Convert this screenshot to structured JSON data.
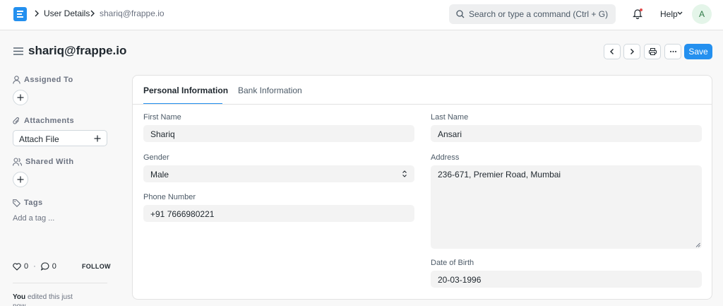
{
  "navbar": {
    "breadcrumb": [
      "User Details",
      "shariq@frappe.io"
    ],
    "search_placeholder": "Search or type a command (Ctrl + G)",
    "help_label": "Help",
    "avatar_initial": "A"
  },
  "page": {
    "title": "shariq@frappe.io",
    "save_label": "Save"
  },
  "sidebar": {
    "assigned_to_label": "Assigned To",
    "attachments_label": "Attachments",
    "attach_file_label": "Attach File",
    "shared_with_label": "Shared With",
    "tags_label": "Tags",
    "add_tag_label": "Add a tag ...",
    "likes_count": "0",
    "comments_count": "0",
    "follow_label": "FOLLOW",
    "activity_user": "You",
    "activity_text": "edited this just now"
  },
  "form": {
    "tabs": [
      "Personal Information",
      "Bank Information"
    ],
    "fields": {
      "first_name": {
        "label": "First Name",
        "value": "Shariq"
      },
      "last_name": {
        "label": "Last Name",
        "value": "Ansari"
      },
      "gender": {
        "label": "Gender",
        "value": "Male"
      },
      "address": {
        "label": "Address",
        "value": "236-671, Premier Road, Mumbai"
      },
      "phone": {
        "label": "Phone Number",
        "value": "+91 7666980221"
      },
      "dob": {
        "label": "Date of Birth",
        "value": "20-03-1996"
      }
    }
  },
  "colors": {
    "accent": "#2490ef",
    "notification_dot": "#e24c4c"
  }
}
